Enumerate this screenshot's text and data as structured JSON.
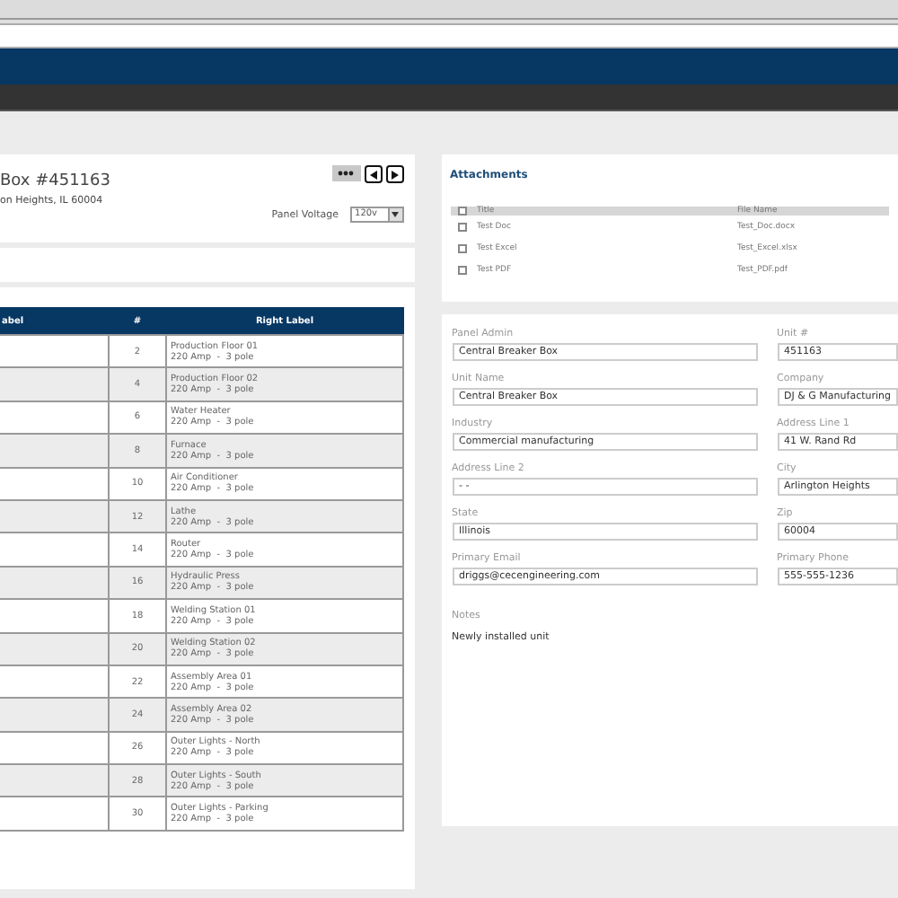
{
  "panel": {
    "title": "Box #451163",
    "address": "on Heights, IL 60004",
    "voltage_label": "Panel Voltage",
    "voltage": "120v"
  },
  "circuits": {
    "columns": [
      "abel",
      "#",
      "Right Label"
    ],
    "rows": [
      {
        "number": "2",
        "right_label": "Production Floor 01",
        "rating": "220 Amp  -  3 pole"
      },
      {
        "number": "4",
        "right_label": "Production Floor 02",
        "rating": "220 Amp  -  3 pole"
      },
      {
        "number": "6",
        "right_label": "Water Heater",
        "rating": "220 Amp  -  3 pole"
      },
      {
        "number": "8",
        "right_label": "Furnace",
        "rating": "220 Amp  -  3 pole"
      },
      {
        "number": "10",
        "right_label": "Air Conditioner",
        "rating": "220 Amp  -  3 pole"
      },
      {
        "number": "12",
        "right_label": "Lathe",
        "rating": "220 Amp  -  3 pole"
      },
      {
        "number": "14",
        "right_label": "Router",
        "rating": "220 Amp  -  3 pole"
      },
      {
        "number": "16",
        "right_label": "Hydraulic Press",
        "rating": "220 Amp  -  3 pole"
      },
      {
        "number": "18",
        "right_label": "Welding Station 01",
        "rating": "220 Amp  -  3 pole"
      },
      {
        "number": "20",
        "right_label": "Welding Station 02",
        "rating": "220 Amp  -  3 pole"
      },
      {
        "number": "22",
        "right_label": "Assembly Area 01",
        "rating": "220 Amp  -  3 pole"
      },
      {
        "number": "24",
        "right_label": "Assembly Area 02",
        "rating": "220 Amp  -  3 pole"
      },
      {
        "number": "26",
        "right_label": "Outer Lights - North",
        "rating": "220 Amp  -  3 pole"
      },
      {
        "number": "28",
        "right_label": "Outer Lights - South",
        "rating": "220 Amp  -  3 pole"
      },
      {
        "number": "30",
        "right_label": "Outer Lights - Parking",
        "rating": "220 Amp  -  3 pole"
      }
    ]
  },
  "attachments": {
    "title": "Attachments",
    "header_checked": false,
    "columns": [
      "Title",
      "File Name"
    ],
    "rows": [
      {
        "title": "Test Doc",
        "file": "Test_Doc.docx",
        "checked": false
      },
      {
        "title": "Test Excel",
        "file": "Test_Excel.xlsx",
        "checked": false
      },
      {
        "title": "Test PDF",
        "file": "Test_PDF.pdf",
        "checked": false
      }
    ]
  },
  "details": {
    "fields": [
      {
        "label": "Panel Admin",
        "value": "Central Breaker Box"
      },
      {
        "label": "Unit #",
        "value": "451163"
      },
      {
        "label": "Unit Name",
        "value": "Central Breaker Box"
      },
      {
        "label": "Company",
        "value": "DJ & G Manufacturing"
      },
      {
        "label": "Industry",
        "value": "Commercial manufacturing"
      },
      {
        "label": "Address Line 1",
        "value": "41 W. Rand Rd"
      },
      {
        "label": "Address Line 2",
        "value": "- -"
      },
      {
        "label": "City",
        "value": "Arlington Heights"
      },
      {
        "label": "State",
        "value": "Illinois"
      },
      {
        "label": "Zip",
        "value": "60004"
      },
      {
        "label": "Primary Email",
        "value": "driggs@cecengineering.com"
      },
      {
        "label": "Primary Phone",
        "value": "555-555-1236"
      }
    ],
    "notes_label": "Notes",
    "notes": "Newly installed unit"
  }
}
